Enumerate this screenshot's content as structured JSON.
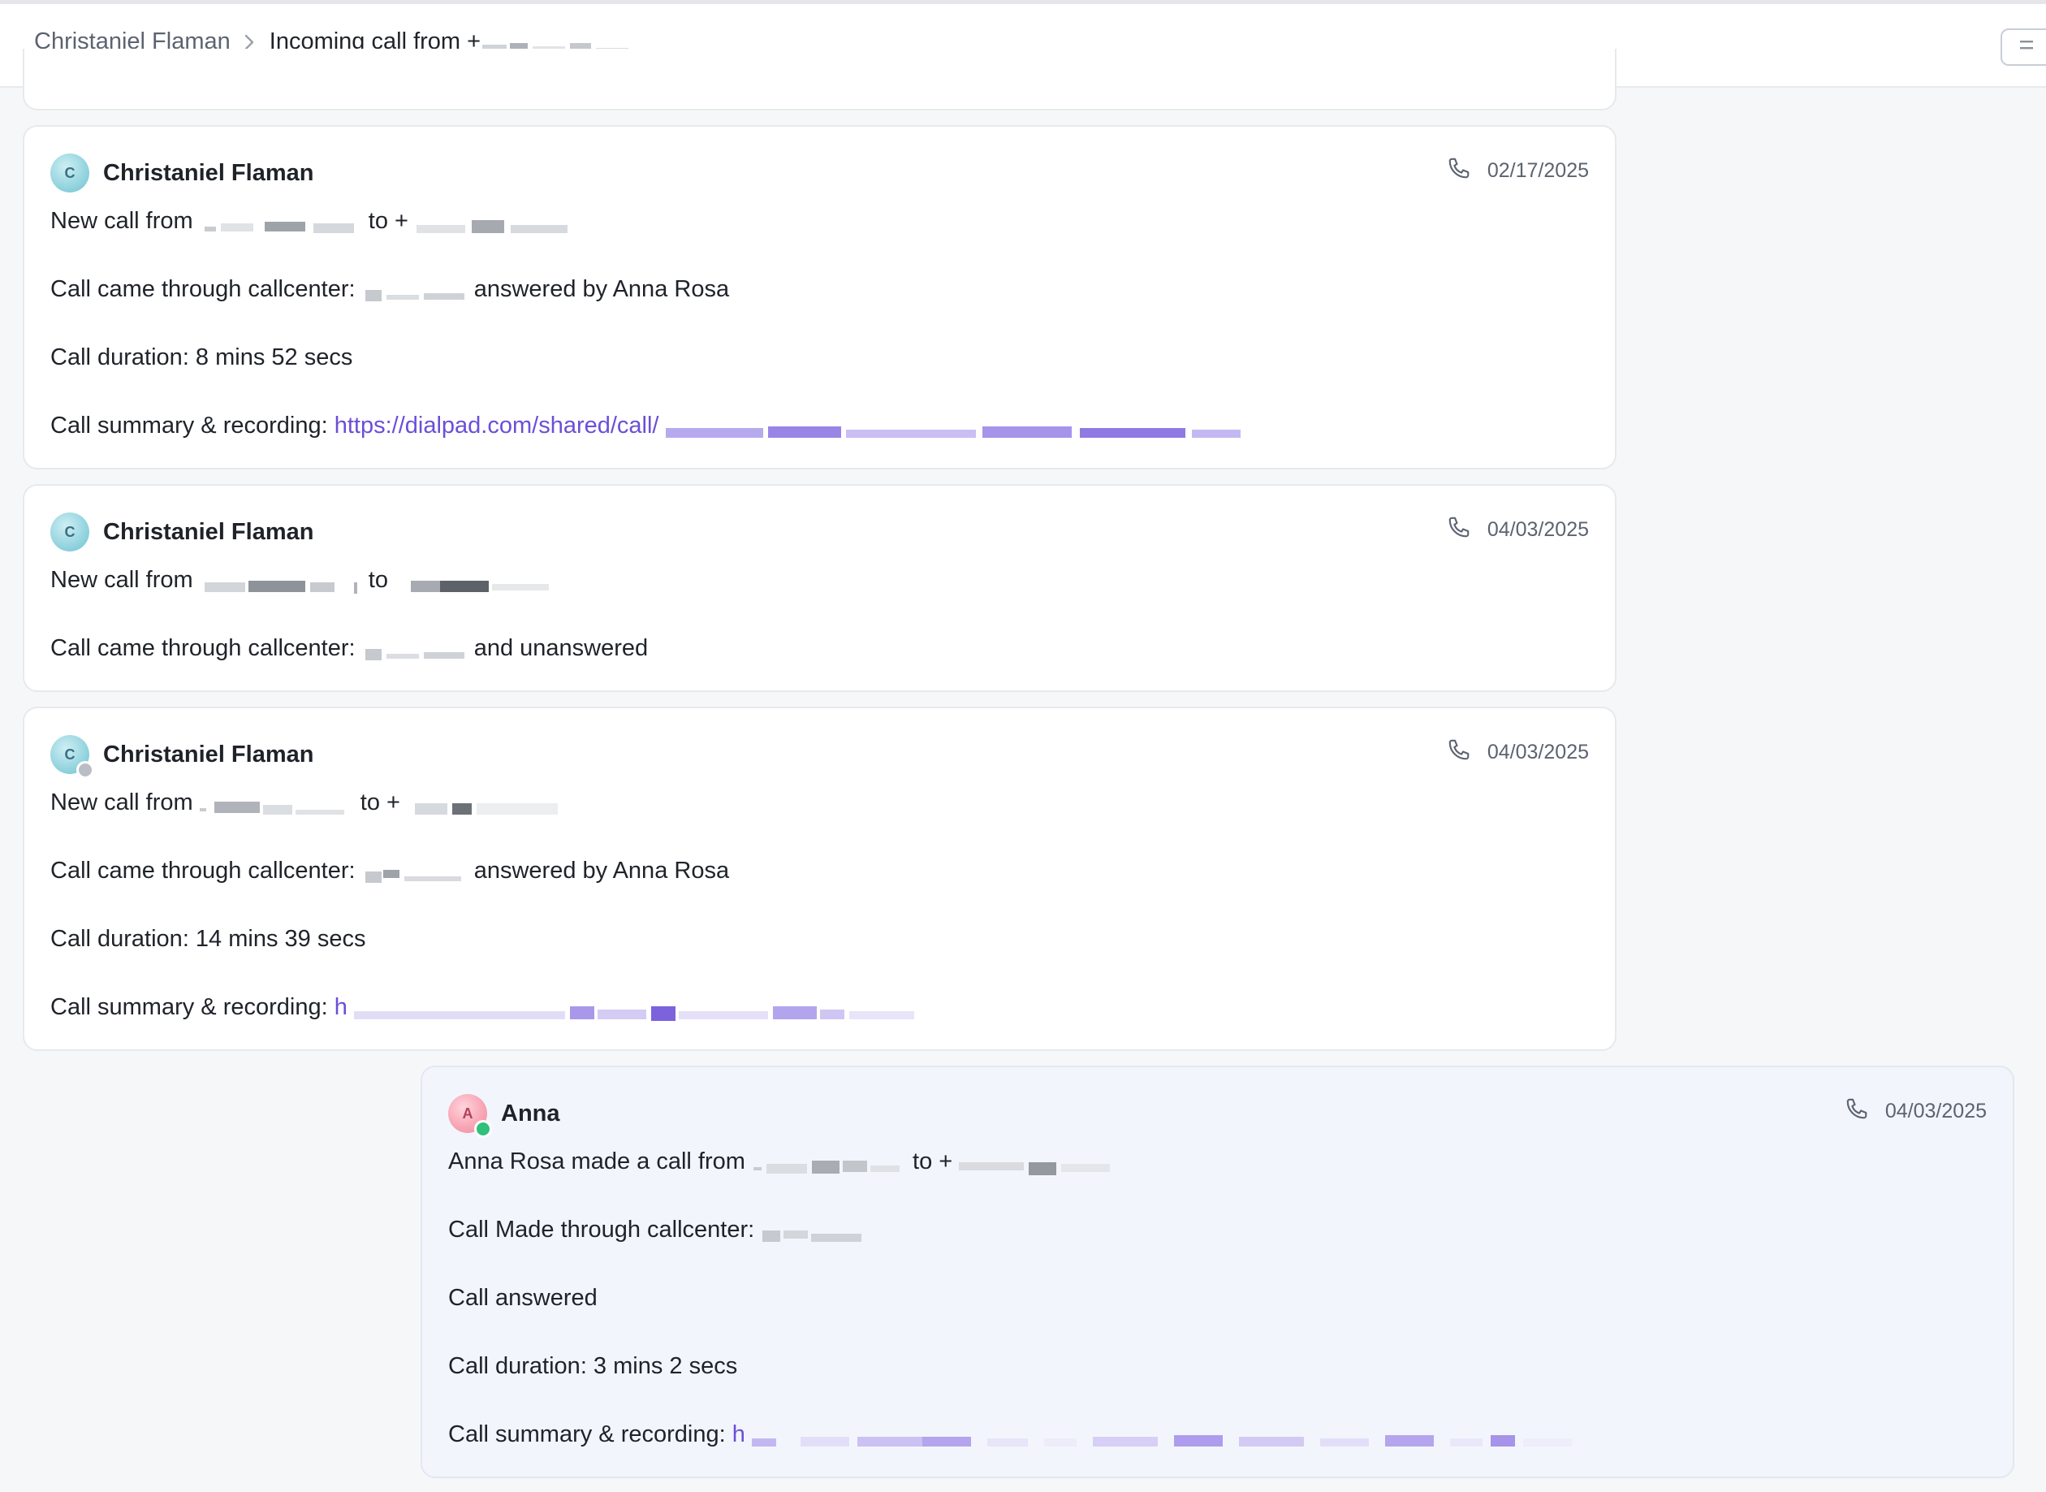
{
  "breadcrumb": {
    "parent": "Christaniel Flaman",
    "current": "Incoming call from +"
  },
  "cards": [
    {
      "author": "Christaniel Flaman",
      "avatar_initial": "C",
      "date": "02/17/2025",
      "lines": {
        "new_call": "New call from",
        "to": "to +",
        "callcenter_prefix": "Call came through callcenter:",
        "callcenter_suffix": "answered by Anna Rosa",
        "duration": "Call duration: 8 mins 52 secs",
        "summary": "Call summary & recording:",
        "summary_link": "https://dialpad.com/shared/call/"
      }
    },
    {
      "author": "Christaniel Flaman",
      "avatar_initial": "C",
      "date": "04/03/2025",
      "lines": {
        "new_call": "New call from",
        "to": "to",
        "callcenter_prefix": "Call came through callcenter:",
        "callcenter_suffix": "and unanswered"
      }
    },
    {
      "author": "Christaniel Flaman",
      "avatar_initial": "C",
      "date": "04/03/2025",
      "lines": {
        "new_call": "New call from",
        "to": "to +",
        "callcenter_prefix": "Call came through callcenter:",
        "callcenter_suffix": "answered by Anna Rosa",
        "duration": "Call duration: 14 mins 39 secs",
        "summary": "Call summary & recording:",
        "summary_link": "h"
      }
    },
    {
      "author": "Anna",
      "avatar_initial": "A",
      "date": "04/03/2025",
      "lines": {
        "made_call": "Anna Rosa made a call from",
        "to": "to +",
        "callcenter_prefix": "Call Made through callcenter:",
        "answered": "Call answered",
        "duration": "Call duration: 3 mins 2 secs",
        "summary": "Call summary & recording:",
        "summary_link": "h"
      }
    }
  ],
  "icons": [
    "chevron-right-icon",
    "phone-icon",
    "menu-icon"
  ],
  "colors": {
    "link": "#6b4fd8",
    "green_status": "#2fc07a",
    "outgoing_card_bg": "#f2f6fc"
  }
}
